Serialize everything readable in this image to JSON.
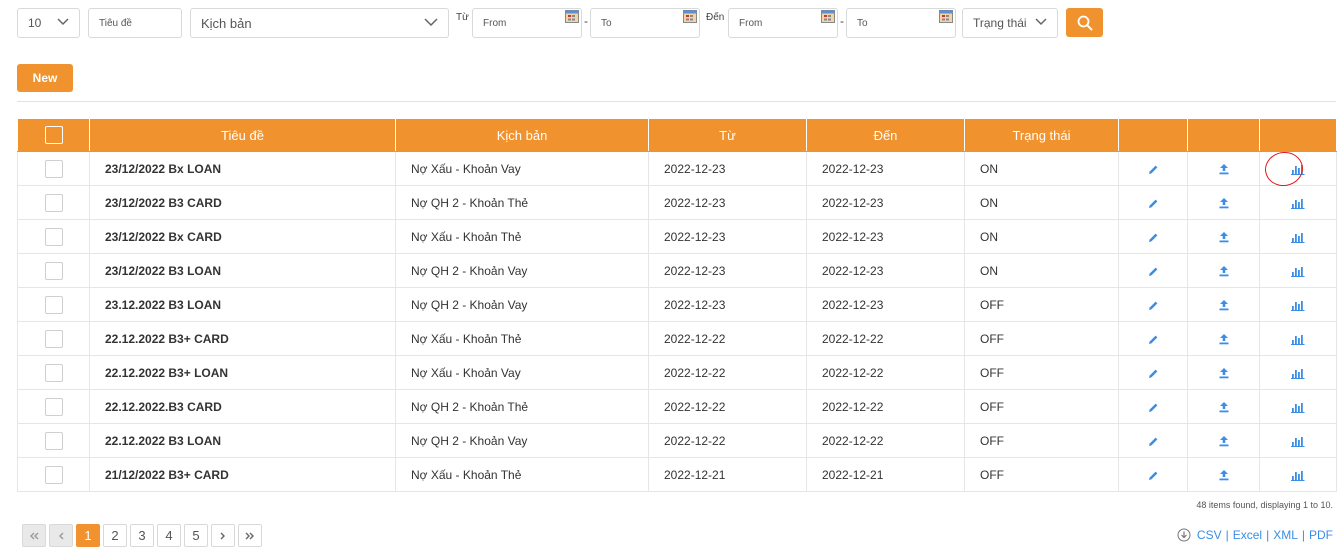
{
  "filters": {
    "page_size": "10",
    "title_placeholder": "Tiêu đề",
    "script_select": "Kịch bản",
    "from_label": "Từ",
    "to_label": "Đến",
    "from_start": "From",
    "from_end": "To",
    "to_start": "From",
    "to_end": "To",
    "status_select": "Trạng thái"
  },
  "toolbar": {
    "new_label": "New"
  },
  "table": {
    "headers": [
      "Tiêu đề",
      "Kịch bản",
      "Từ",
      "Đến",
      "Trạng thái"
    ],
    "rows": [
      {
        "title": "23/12/2022 Bx LOAN",
        "script": "Nợ Xấu - Khoản Vay",
        "from": "2022-12-23",
        "to": "2022-12-23",
        "status": "ON"
      },
      {
        "title": "23/12/2022 B3 CARD",
        "script": "Nợ QH 2 - Khoản Thẻ",
        "from": "2022-12-23",
        "to": "2022-12-23",
        "status": "ON"
      },
      {
        "title": "23/12/2022 Bx CARD",
        "script": "Nợ Xấu - Khoản Thẻ",
        "from": "2022-12-23",
        "to": "2022-12-23",
        "status": "ON"
      },
      {
        "title": "23/12/2022 B3 LOAN",
        "script": "Nợ QH 2 - Khoản Vay",
        "from": "2022-12-23",
        "to": "2022-12-23",
        "status": "ON"
      },
      {
        "title": "23.12.2022 B3 LOAN",
        "script": "Nợ QH 2 - Khoản Vay",
        "from": "2022-12-23",
        "to": "2022-12-23",
        "status": "OFF"
      },
      {
        "title": "22.12.2022 B3+ CARD",
        "script": "Nợ Xấu - Khoản Thẻ",
        "from": "2022-12-22",
        "to": "2022-12-22",
        "status": "OFF"
      },
      {
        "title": "22.12.2022 B3+ LOAN",
        "script": "Nợ Xấu - Khoản Vay",
        "from": "2022-12-22",
        "to": "2022-12-22",
        "status": "OFF"
      },
      {
        "title": "22.12.2022.B3 CARD",
        "script": "Nợ QH 2 - Khoản Thẻ",
        "from": "2022-12-22",
        "to": "2022-12-22",
        "status": "OFF"
      },
      {
        "title": "22.12.2022 B3 LOAN",
        "script": "Nợ QH 2 - Khoản Vay",
        "from": "2022-12-22",
        "to": "2022-12-22",
        "status": "OFF"
      },
      {
        "title": "21/12/2022 B3+ CARD",
        "script": "Nợ Xấu - Khoản Thẻ",
        "from": "2022-12-21",
        "to": "2022-12-21",
        "status": "OFF"
      }
    ]
  },
  "summary": "48 items found, displaying 1 to 10.",
  "pagination": {
    "pages": [
      "1",
      "2",
      "3",
      "4",
      "5"
    ],
    "current": "1"
  },
  "exports": [
    "CSV",
    "Excel",
    "XML",
    "PDF"
  ],
  "icons": {
    "edit": "pencil-icon",
    "upload": "upload-icon",
    "report": "bar-chart-icon",
    "search": "search-icon",
    "calendar": "calendar-icon",
    "download": "download-icon"
  },
  "colors": {
    "accent": "#f0932f",
    "link": "#3a8ee6",
    "annotation": "#e01b1b"
  }
}
